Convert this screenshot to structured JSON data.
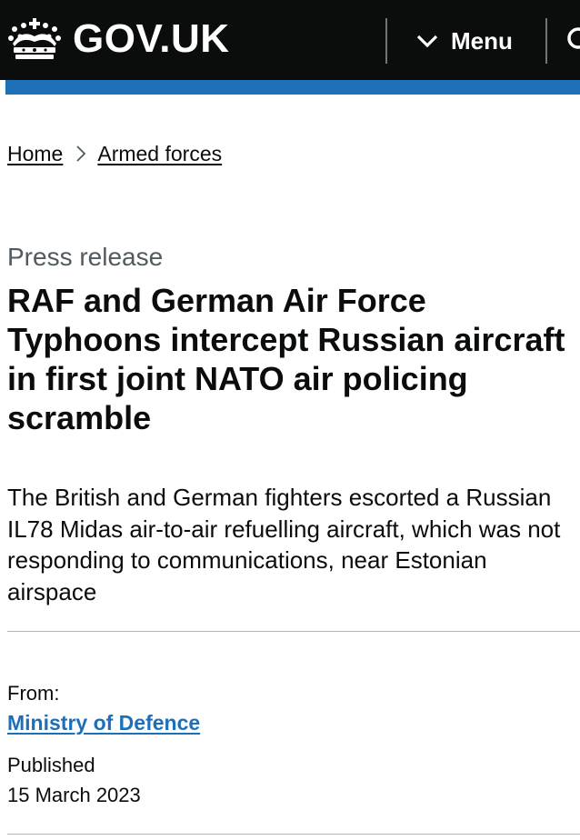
{
  "header": {
    "logo_text": "GOV.UK",
    "menu_label": "Menu",
    "colors": {
      "background": "#0b0c0c",
      "accent_bar": "#1d70b8",
      "link": "#1d70b8"
    },
    "icons": [
      "crown-icon",
      "chevron-down-icon",
      "search-icon"
    ]
  },
  "breadcrumb": {
    "items": [
      {
        "label": "Home"
      },
      {
        "label": "Armed forces"
      }
    ]
  },
  "article": {
    "caption": "Press release",
    "title": "RAF and German Air Force Typhoons intercept Russian aircraft in first joint NATO air policing scramble",
    "lead": "The British and German fighters escorted a Russian IL78 Midas air-to-air refuelling aircraft, which was not responding to communications, near Estonian airspace"
  },
  "metadata": {
    "from_label": "From:",
    "organisation": "Ministry of Defence",
    "published_label": "Published",
    "published_date": "15 March 2023"
  }
}
